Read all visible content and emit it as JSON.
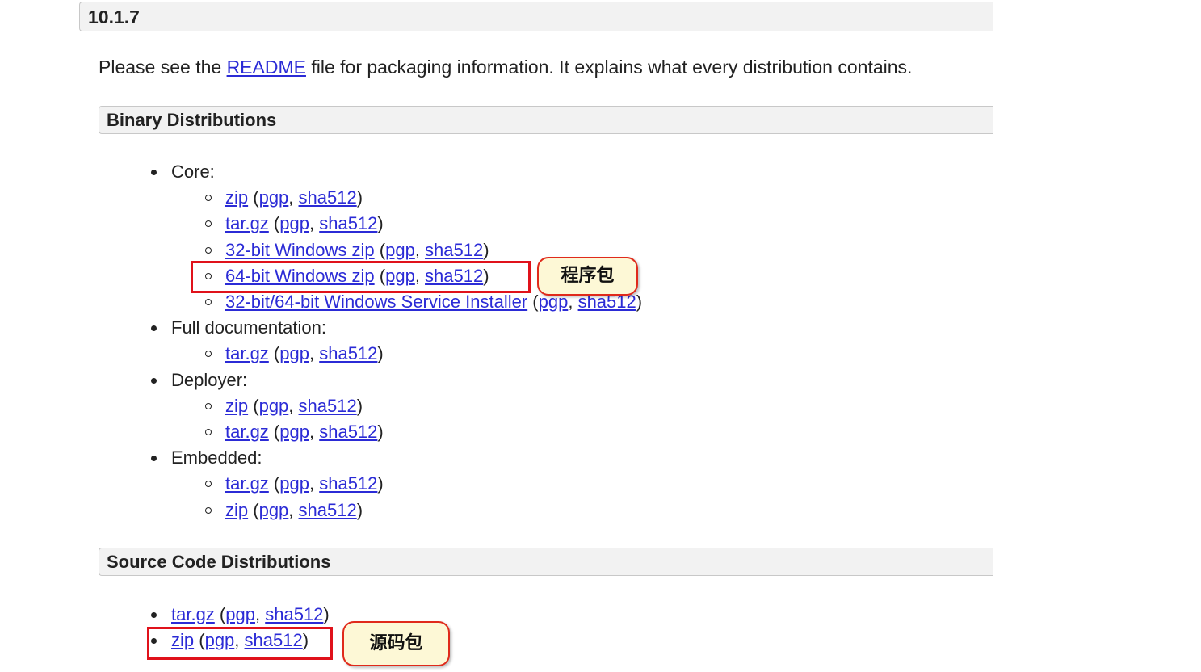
{
  "version_heading": "10.1.7",
  "intro": {
    "before": "Please see the ",
    "link": "README",
    "after": " file for packaging information. It explains what every distribution contains."
  },
  "binary": {
    "heading": "Binary Distributions",
    "core": {
      "label": "Core:",
      "items": [
        {
          "main": "zip",
          "pgp": "pgp",
          "sha": "sha512"
        },
        {
          "main": "tar.gz",
          "pgp": "pgp",
          "sha": "sha512"
        },
        {
          "main": "32-bit Windows zip",
          "pgp": "pgp",
          "sha": "sha512"
        },
        {
          "main": "64-bit Windows zip",
          "pgp": "pgp",
          "sha": "sha512"
        },
        {
          "main": "32-bit/64-bit Windows Service Installer",
          "pgp": "pgp",
          "sha": "sha512"
        }
      ]
    },
    "docs": {
      "label": "Full documentation:",
      "items": [
        {
          "main": "tar.gz",
          "pgp": "pgp",
          "sha": "sha512"
        }
      ]
    },
    "deployer": {
      "label": "Deployer:",
      "items": [
        {
          "main": "zip",
          "pgp": "pgp",
          "sha": "sha512"
        },
        {
          "main": "tar.gz",
          "pgp": "pgp",
          "sha": "sha512"
        }
      ]
    },
    "embedded": {
      "label": "Embedded:",
      "items": [
        {
          "main": "tar.gz",
          "pgp": "pgp",
          "sha": "sha512"
        },
        {
          "main": "zip",
          "pgp": "pgp",
          "sha": "sha512"
        }
      ]
    }
  },
  "source": {
    "heading": "Source Code Distributions",
    "items": [
      {
        "main": "tar.gz",
        "pgp": "pgp",
        "sha": "sha512"
      },
      {
        "main": "zip",
        "pgp": "pgp",
        "sha": "sha512"
      }
    ]
  },
  "annotations": {
    "program_package": "程序包",
    "source_package": "源码包"
  },
  "colors": {
    "link": "#2b2bd6",
    "highlight_border": "#e0121b",
    "callout_fill": "#fdf8d6"
  }
}
